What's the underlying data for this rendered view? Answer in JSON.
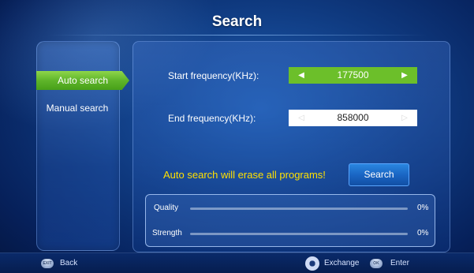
{
  "title": "Search",
  "menu": {
    "items": [
      {
        "label": "Auto search",
        "active": true
      },
      {
        "label": "Manual search",
        "active": false
      }
    ]
  },
  "form": {
    "start_label": "Start frequency(KHz):",
    "start_value": "177500",
    "end_label": "End frequency(KHz):",
    "end_value": "858000"
  },
  "warning": "Auto search will erase all programs!",
  "search_button": "Search",
  "signal": {
    "quality_label": "Quality",
    "quality_value": "0%",
    "quality_fraction": 0,
    "strength_label": "Strength",
    "strength_value": "0%",
    "strength_fraction": 0
  },
  "footer": {
    "back_icon_text": "EXIT",
    "back_label": "Back",
    "exchange_label": "Exchange",
    "ok_icon_text": "OK",
    "enter_label": "Enter"
  },
  "colors": {
    "accent_green": "#6cbf2a",
    "warning_yellow": "#ffe000",
    "button_blue": "#1a66c4"
  },
  "icons": {
    "back": "exit-key-icon",
    "exchange": "dpad-icon",
    "enter": "ok-key-icon",
    "left": "arrow-left-icon",
    "right": "arrow-right-icon"
  }
}
